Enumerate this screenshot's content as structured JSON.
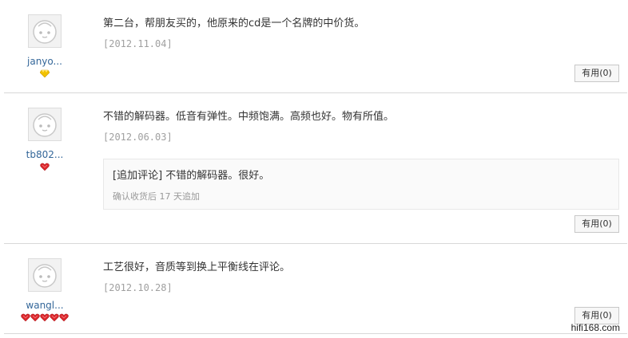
{
  "reviews": [
    {
      "username": "janyo...",
      "rank": "gold-diamond-icon",
      "text": "第二台，帮朋友买的，他原来的cd是一个名牌的中价货。",
      "date": "[2012.11.04]",
      "useful_label": "有用(0)"
    },
    {
      "username": "tb802...",
      "rank": "red-heart-icon",
      "text": "不错的解码器。低音有弹性。中频饱满。高频也好。物有所值。",
      "date": "[2012.06.03]",
      "append_text": "[追加评论] 不错的解码器。很好。",
      "append_note": "确认收货后 17 天追加",
      "useful_label": "有用(0)"
    },
    {
      "username": "wangl...",
      "rank": "red-heart-icon",
      "rank_count": 5,
      "text": "工艺很好，音质等到换上平衡线在评论。",
      "date": "[2012.10.28]",
      "useful_label": "有用(0)"
    }
  ],
  "watermark": "hifi168.com",
  "colors": {
    "username": "#336699",
    "date": "#a0a0a0",
    "divider": "#d8d8d8",
    "gold_gem": "#f2c200",
    "red_gem": "#d9262b"
  }
}
